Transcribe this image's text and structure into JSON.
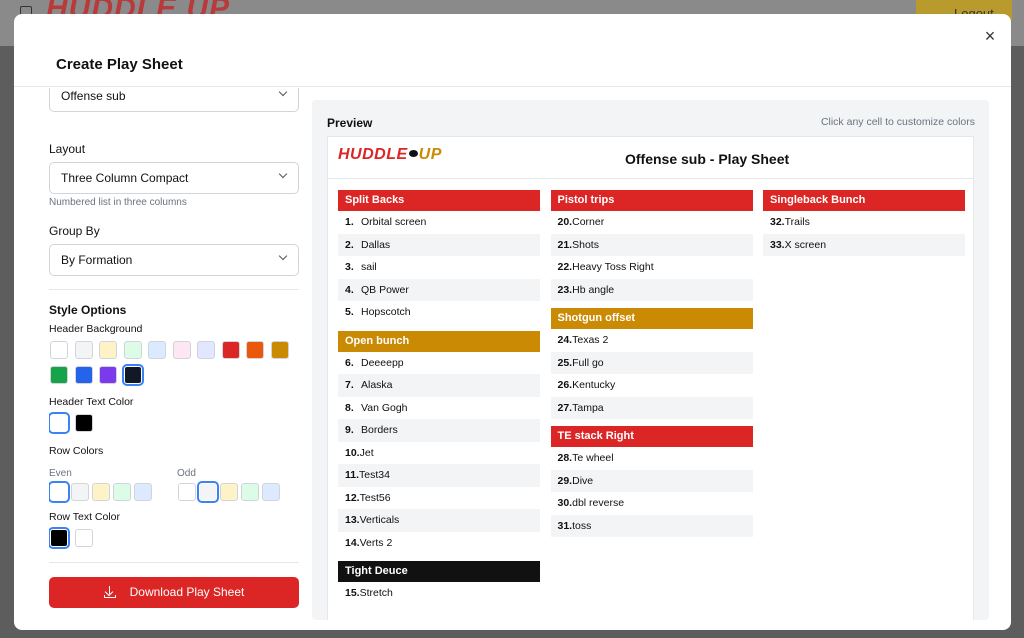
{
  "backdrop": {
    "logo": "HUDDLE UP",
    "logout": "Logout"
  },
  "modal": {
    "title": "Create Play Sheet",
    "close": "×"
  },
  "form": {
    "sheet_select": "Offense sub",
    "layout_label": "Layout",
    "layout_value": "Three Column Compact",
    "layout_hint": "Numbered list in three columns",
    "group_by_label": "Group By",
    "group_by_value": "By Formation",
    "style_options": "Style Options",
    "header_background": "Header Background",
    "header_bg_colors": [
      "#ffffff",
      "#f3f4f6",
      "#fef3c7",
      "#dcfce7",
      "#dbeafe",
      "#fce7f3",
      "#e0e7ff",
      "#dc2626",
      "#ea580c",
      "#ca8a04",
      "#16a34a",
      "#2563eb",
      "#7c3aed",
      "#111827"
    ],
    "header_text_color": "Header Text Color",
    "header_text_colors": [
      "#ffffff",
      "#000000"
    ],
    "row_colors": "Row Colors",
    "even_label": "Even",
    "odd_label": "Odd",
    "even_colors": [
      "#ffffff",
      "#f3f4f6",
      "#fef3c7",
      "#dcfce7",
      "#dbeafe"
    ],
    "odd_colors": [
      "#ffffff",
      "#f3f4f6",
      "#fef3c7",
      "#dcfce7",
      "#dbeafe"
    ],
    "row_text_color": "Row Text Color",
    "row_text_colors": [
      "#000000",
      "#ffffff"
    ],
    "download": "Download Play Sheet"
  },
  "preview": {
    "title": "Preview",
    "hint": "Click any cell to customize colors",
    "sheet_logo_a": "HUDDLE",
    "sheet_logo_b": "UP",
    "sheet_title": "Offense sub - Play Sheet"
  },
  "columns": [
    [
      {
        "name": "Split Backs",
        "color": "#dc2626",
        "plays": [
          [
            "1.",
            "Orbital screen"
          ],
          [
            "2.",
            "Dallas"
          ],
          [
            "3.",
            "sail"
          ],
          [
            "4.",
            "QB Power"
          ],
          [
            "5.",
            "Hopscotch"
          ]
        ]
      },
      {
        "name": "Open bunch",
        "color": "#ca8a04",
        "plays": [
          [
            "6.",
            "Deeeepp"
          ],
          [
            "7.",
            "Alaska"
          ],
          [
            "8.",
            "Van Gogh"
          ],
          [
            "9.",
            "Borders"
          ],
          [
            "10.",
            "Jet"
          ],
          [
            "11.",
            "Test34"
          ],
          [
            "12.",
            "Test56"
          ],
          [
            "13.",
            "Verticals"
          ],
          [
            "14.",
            "Verts 2"
          ]
        ]
      },
      {
        "name": "Tight Deuce",
        "color": "#111111",
        "plays": [
          [
            "15.",
            "Stretch"
          ]
        ]
      }
    ],
    [
      {
        "name": "Pistol trips",
        "color": "#dc2626",
        "plays": [
          [
            "20.",
            "Corner"
          ],
          [
            "21.",
            "Shots"
          ],
          [
            "22.",
            "Heavy Toss Right"
          ],
          [
            "23.",
            "Hb angle"
          ]
        ]
      },
      {
        "name": "Shotgun offset",
        "color": "#ca8a04",
        "plays": [
          [
            "24.",
            "Texas 2"
          ],
          [
            "25.",
            "Full go"
          ],
          [
            "26.",
            "Kentucky"
          ],
          [
            "27.",
            "Tampa"
          ]
        ]
      },
      {
        "name": "TE stack Right",
        "color": "#dc2626",
        "plays": [
          [
            "28.",
            "Te wheel"
          ],
          [
            "29.",
            "Dive"
          ],
          [
            "30.",
            "dbl reverse"
          ],
          [
            "31.",
            "toss"
          ]
        ]
      }
    ],
    [
      {
        "name": "Singleback Bunch",
        "color": "#dc2626",
        "plays": [
          [
            "32.",
            "Trails"
          ],
          [
            "33.",
            "X screen"
          ]
        ]
      }
    ]
  ]
}
